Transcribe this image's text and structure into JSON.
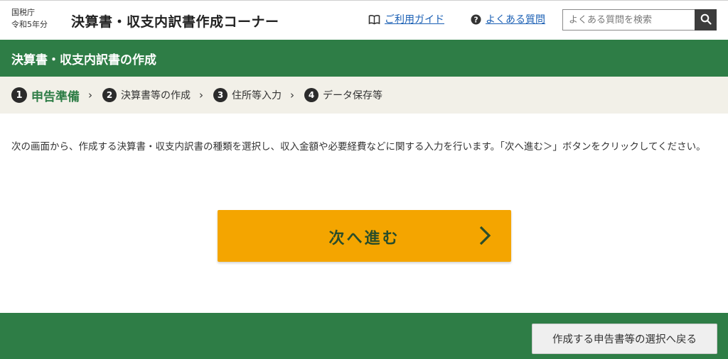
{
  "header": {
    "agency": "国税庁",
    "year": "令和5年分",
    "site_title": "決算書・収支内訳書作成コーナー",
    "guide_link": "ご利用ガイド",
    "faq_link": "よくある質問",
    "search_placeholder": "よくある質問を検索"
  },
  "page_title": "決算書・収支内訳書の作成",
  "steps": [
    {
      "num": "1",
      "label": "申告準備"
    },
    {
      "num": "2",
      "label": "決算書等の作成"
    },
    {
      "num": "3",
      "label": "住所等入力"
    },
    {
      "num": "4",
      "label": "データ保存等"
    }
  ],
  "step_separator": "›",
  "instruction": "次の画面から、作成する決算書・収支内訳書の種類を選択し、収入金額や必要経費などに関する入力を行います。「次へ進む＞」ボタンをクリックしてください。",
  "next_button": "次へ進む",
  "back_button": "作成する申告書等の選択へ戻る",
  "colors": {
    "brand_green": "#2e7d46",
    "next_orange": "#f4a500",
    "link_blue": "#1a5fb4",
    "steps_bg": "#f2f0e8"
  },
  "icons": {
    "guide": "book-icon",
    "faq": "question-circle-icon",
    "search": "magnifier-icon",
    "next": "chevron-right-icon"
  }
}
